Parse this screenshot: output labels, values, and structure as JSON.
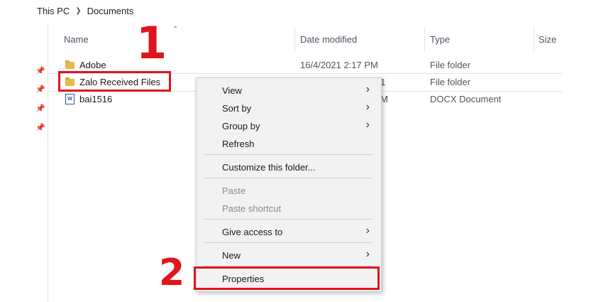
{
  "breadcrumb": {
    "root": "This PC",
    "current": "Documents"
  },
  "columns": {
    "name": "Name",
    "date": "Date modified",
    "type": "Type",
    "size": "Size"
  },
  "files": [
    {
      "name": "Adobe",
      "date": "16/4/2021 2:17 PM",
      "type": "File folder",
      "icon": "folder-icon"
    },
    {
      "name": "Zalo Received Files",
      "date": "",
      "type": "File folder",
      "icon": "folder-icon"
    },
    {
      "name": "bai1516",
      "date": "",
      "type": "DOCX Document",
      "icon": "docx-icon"
    }
  ],
  "partial_date_text": {
    "row2": "1",
    "row3": "M"
  },
  "context_menu": {
    "items": [
      {
        "label": "View",
        "submenu": true
      },
      {
        "label": "Sort by",
        "submenu": true
      },
      {
        "label": "Group by",
        "submenu": true
      },
      {
        "label": "Refresh",
        "submenu": false
      },
      {
        "label": "Customize this folder...",
        "submenu": false
      },
      {
        "label": "Paste",
        "submenu": false,
        "disabled": true
      },
      {
        "label": "Paste shortcut",
        "submenu": false,
        "disabled": true
      },
      {
        "label": "Give access to",
        "submenu": true
      },
      {
        "label": "New",
        "submenu": true
      },
      {
        "label": "Properties",
        "submenu": false
      }
    ]
  },
  "annotations": {
    "step1": "1",
    "step2": "2"
  },
  "colors": {
    "annotation_red": "#e0151d",
    "folder": "#e8b94a",
    "menu_bg": "#f2f2f2"
  }
}
